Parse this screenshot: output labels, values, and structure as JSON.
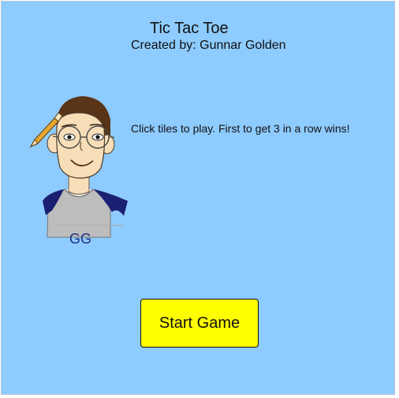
{
  "game": {
    "title": "Tic Tac Toe",
    "credit": "Created by: Gunnar Golden",
    "instructions": "Click tiles to play. First to get 3 in a row wins!",
    "avatar_initials": "GG",
    "start_button_label": "Start Game"
  },
  "colors": {
    "background": "#8ecbff",
    "button": "#ffff00",
    "avatar_shirt": "#bdbdbd",
    "avatar_sleeves": "#1b1f72",
    "initials_text": "#1f2f86"
  },
  "icons": {
    "avatar": "cartoon-boy-with-glasses-icon",
    "pencil": "pencil-icon"
  }
}
